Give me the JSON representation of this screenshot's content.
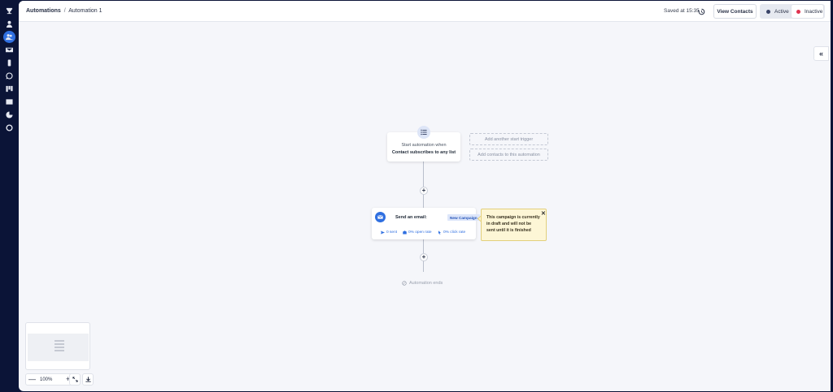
{
  "header": {
    "breadcrumb_root": "Automations",
    "breadcrumb_separator": "/",
    "breadcrumb_current": "Automation 1",
    "saved_status": "Saved at 15:35",
    "view_contacts_label": "View Contacts",
    "status_active_label": "Active",
    "status_inactive_label": "Inactive",
    "status_selected": "Inactive"
  },
  "sidebar": {
    "icons": [
      "trophy-icon",
      "user-icon",
      "contacts-icon",
      "mail-icon",
      "phone-icon",
      "whatsapp-icon",
      "kanban-icon",
      "template-icon",
      "chart-icon",
      "globe-icon"
    ],
    "active_index": 2
  },
  "flow": {
    "trigger_subtitle": "Start automation when",
    "trigger_title": "Contact subscribes to any list",
    "add_trigger_label": "Add another start trigger",
    "add_contacts_label": "Add contacts to this automation",
    "email_label": "Send an email:",
    "campaign_tag": "New Campaign",
    "stats": [
      "0 sent",
      "0% open rate",
      "0% click rate"
    ],
    "warning_text": "This campaign is currently in draft and will not be sent until it is finished",
    "warning_close": "✕",
    "end_label": "Automation ends"
  },
  "canvas": {
    "zoom_level": "100%",
    "zoom_minus": "—",
    "zoom_plus": "+",
    "collapse_symbol": "«"
  },
  "colors": {
    "accent": "#2f6fe0",
    "rail": "#0b1437",
    "active_dot": "#3a4468",
    "inactive_dot": "#e0334f",
    "warning_bg": "#fdf6d6"
  }
}
